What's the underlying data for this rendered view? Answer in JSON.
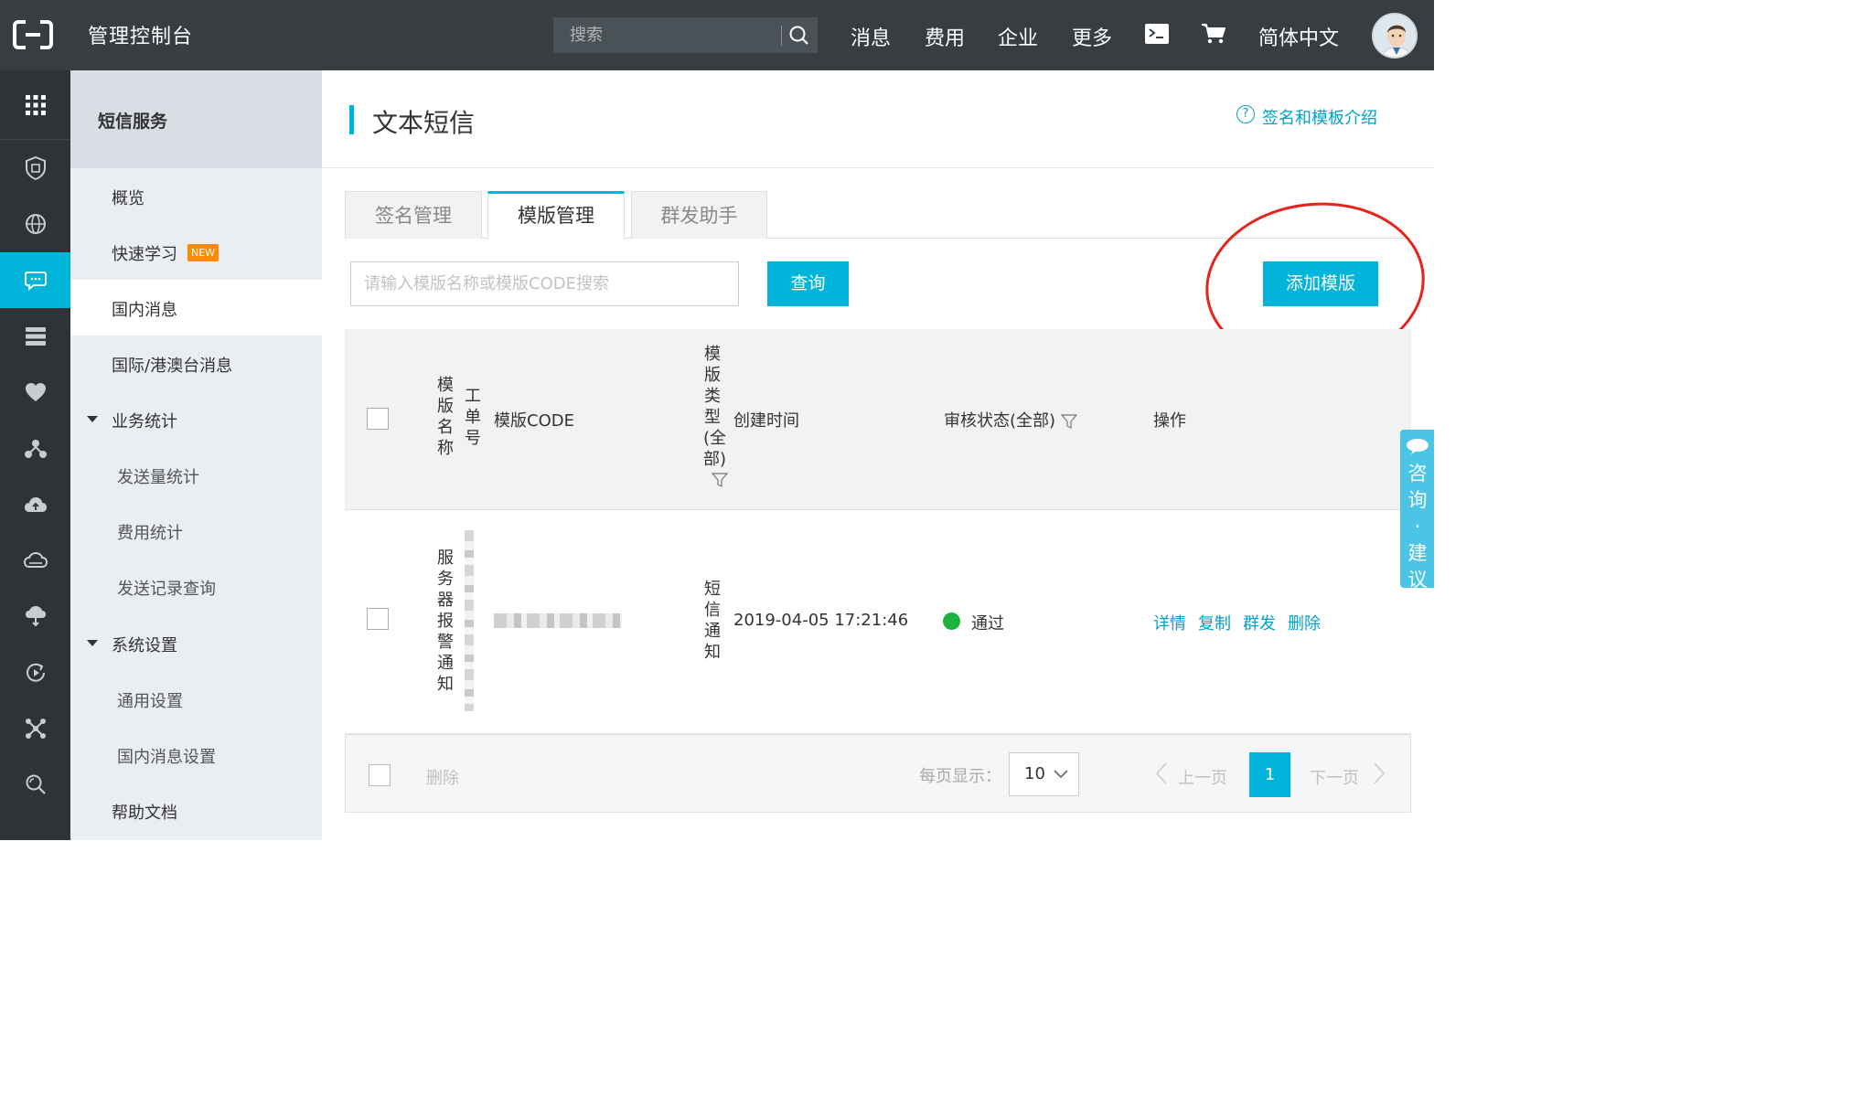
{
  "topbar": {
    "app_title": "管理控制台",
    "search_placeholder": "搜索",
    "links": [
      "消息",
      "费用",
      "企业",
      "更多"
    ],
    "language": "简体中文"
  },
  "rail": {
    "icons": [
      "grid-icon",
      "shield-icon",
      "globe-icon",
      "message-icon",
      "server-icon",
      "heart-icon",
      "network-icon",
      "cloud-upload-icon",
      "cloud-icon",
      "cloud-sync-icon",
      "play-cycle-icon",
      "nodes-icon",
      "search-settings-icon"
    ],
    "active_index": 3
  },
  "sidemenu": {
    "title": "短信服务",
    "items": [
      {
        "label": "概览"
      },
      {
        "label": "快速学习",
        "badge": "NEW"
      },
      {
        "label": "国内消息"
      },
      {
        "label": "国际/港澳台消息"
      },
      {
        "label": "业务统计"
      },
      {
        "label": "发送量统计"
      },
      {
        "label": "费用统计"
      },
      {
        "label": "发送记录查询"
      },
      {
        "label": "系统设置"
      },
      {
        "label": "通用设置"
      },
      {
        "label": "国内消息设置"
      },
      {
        "label": "帮助文档"
      }
    ]
  },
  "main": {
    "page_title": "文本短信",
    "help_link": "签名和模板介绍",
    "tabs": [
      "签名管理",
      "模版管理",
      "群发助手"
    ],
    "active_tab": 1,
    "query_placeholder": "请输入模版名称或模版CODE搜索",
    "query_button": "查询",
    "add_button": "添加模版"
  },
  "table": {
    "headers": {
      "name": "模版名称",
      "ticket": "工单号",
      "code": "模版CODE",
      "type": "模版类型(全部)",
      "created": "创建时间",
      "status": "审核状态(全部)",
      "actions": "操作"
    },
    "rows": [
      {
        "name": "服务器报警通知",
        "type": "短信通知",
        "created": "2019-04-05 17:21:46",
        "status": "通过",
        "actions": [
          "详情",
          "复制",
          "群发",
          "删除"
        ]
      }
    ],
    "status_color": "#1db33e"
  },
  "footer": {
    "delete_label": "删除",
    "per_page_label": "每页显示：",
    "per_page_value": "10",
    "prev_label": "上一页",
    "next_label": "下一页",
    "current_page": "1"
  },
  "consult_tab": "咨询·建议",
  "colors": {
    "accent": "#00b4da",
    "topbar": "#373d41",
    "link": "#00a2ca",
    "annotation": "#e8231a"
  }
}
